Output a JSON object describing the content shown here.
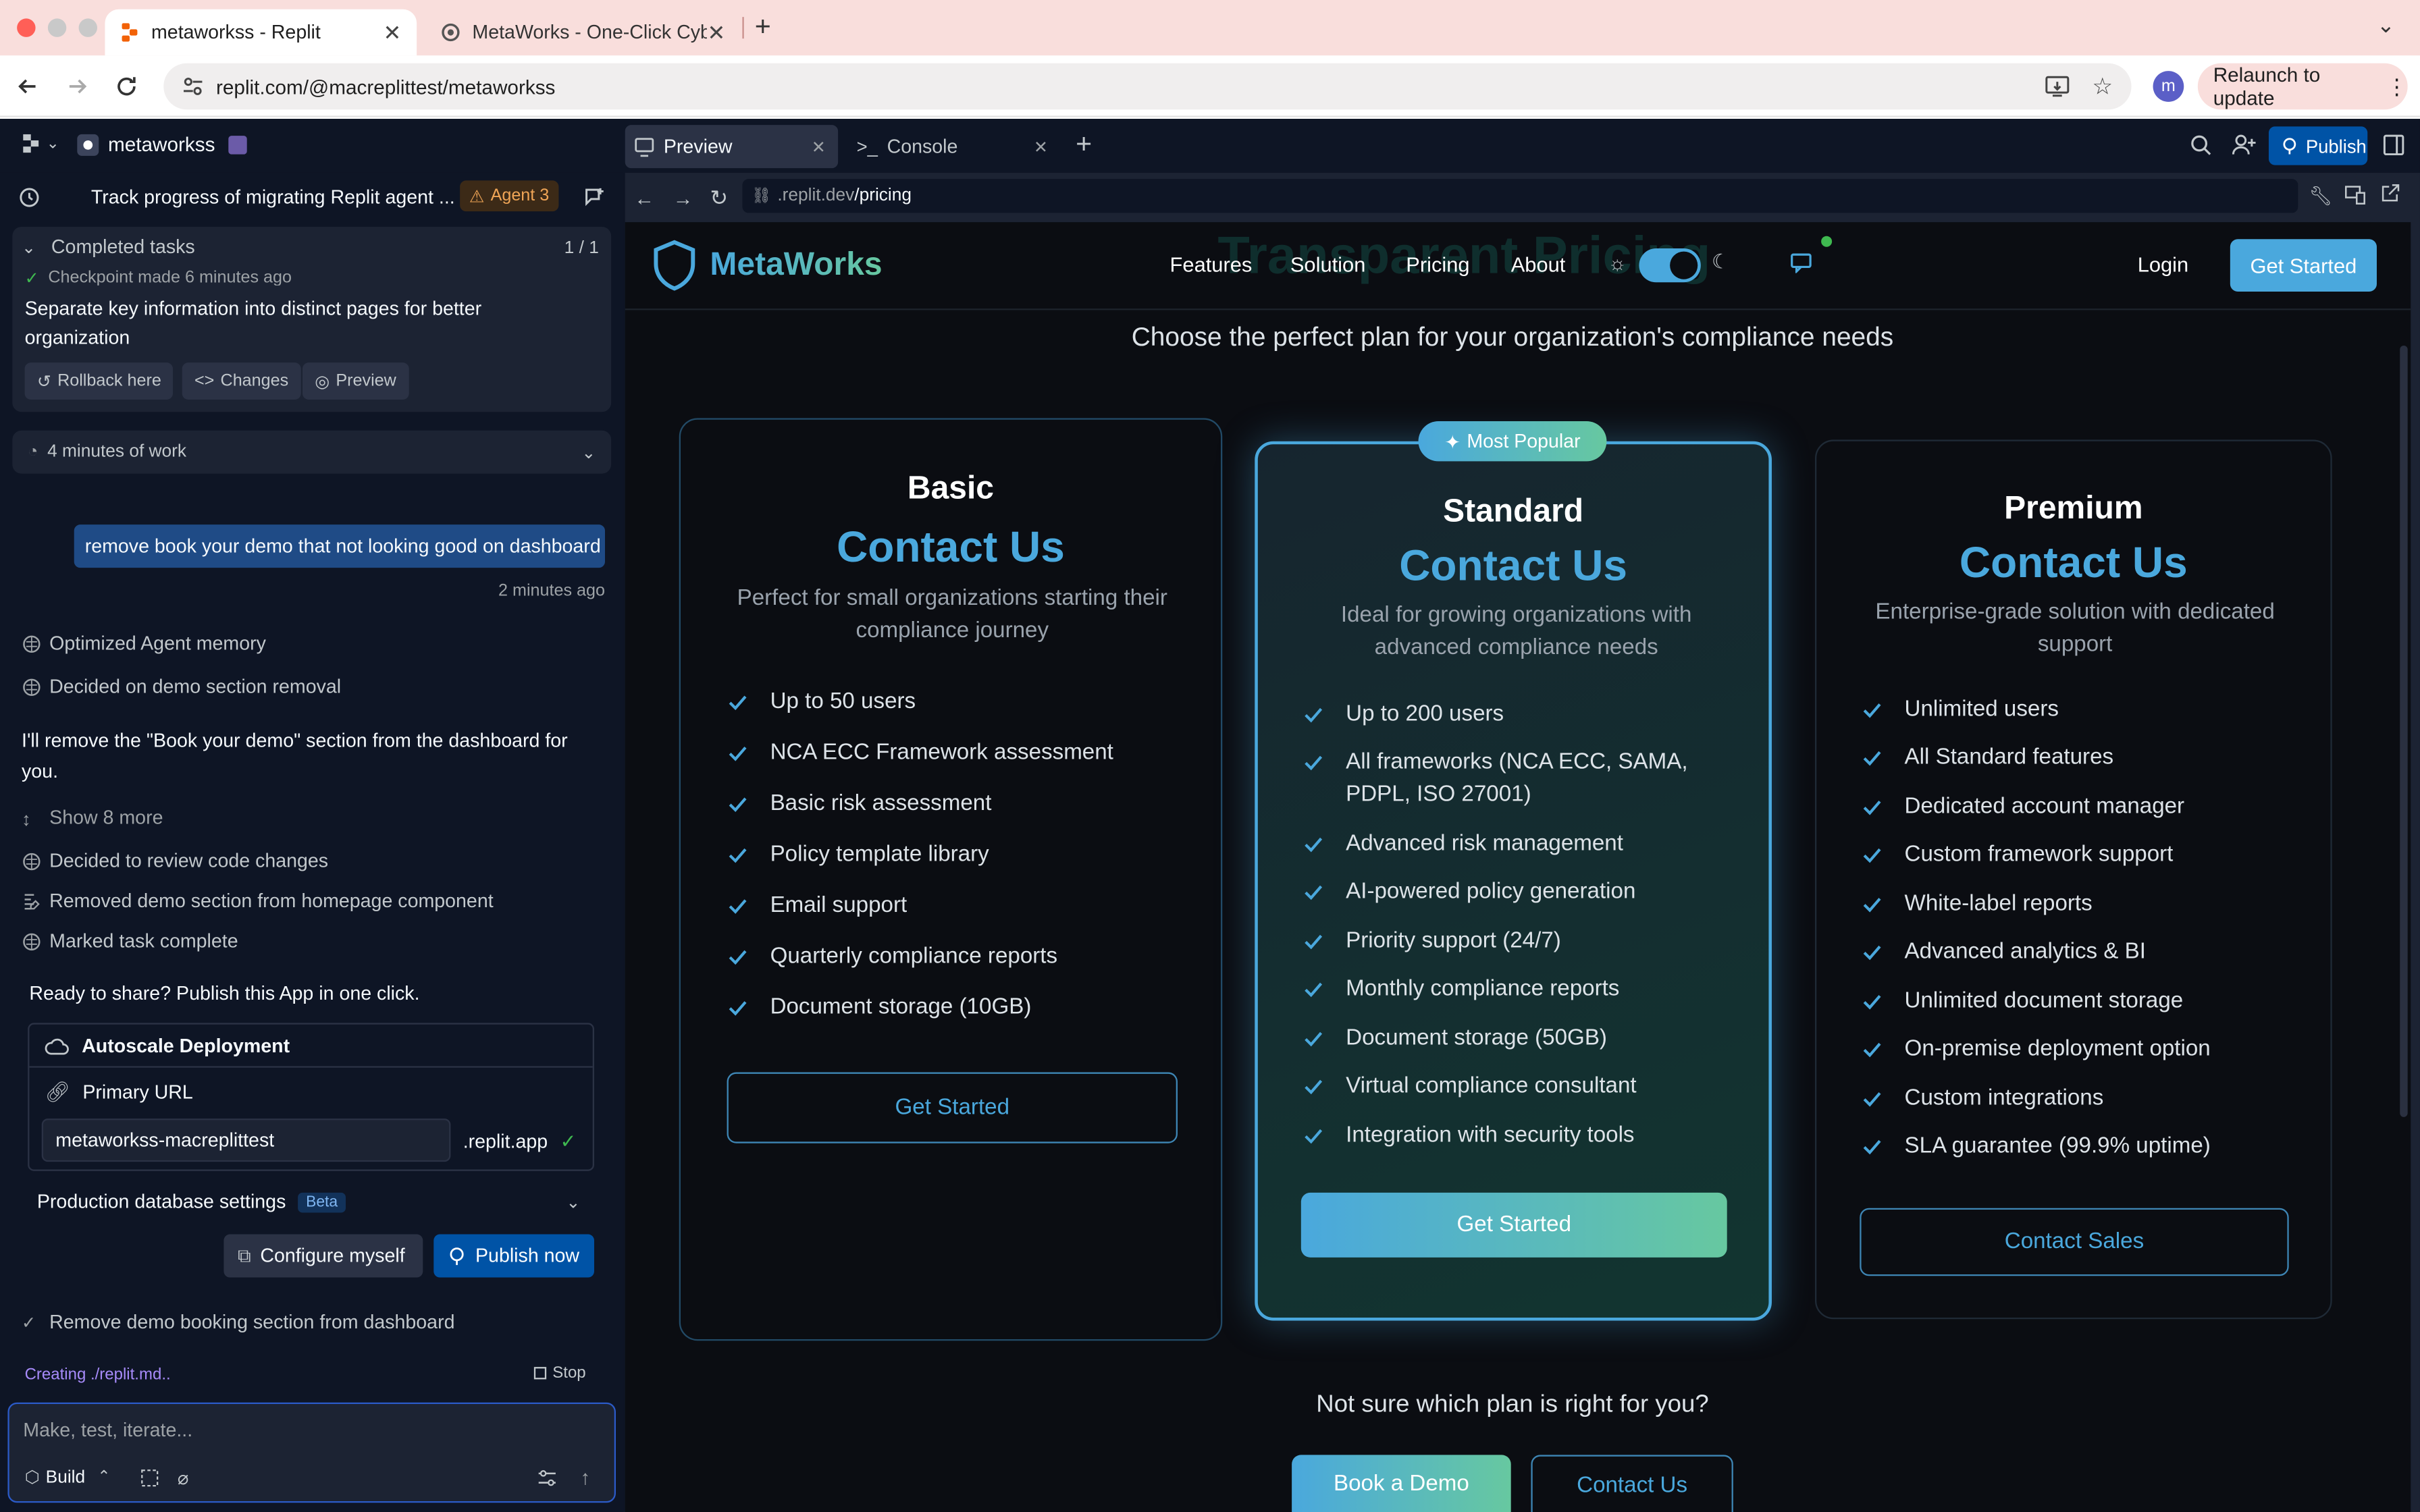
{
  "browser": {
    "tabs": [
      {
        "title": "metaworkss - Replit"
      },
      {
        "title": "MetaWorks - One-Click Cyber..."
      }
    ],
    "url": "replit.com/@macreplittest/metaworkss",
    "relaunch_label": "Relaunch to update",
    "profile_initial": "m"
  },
  "replit": {
    "repl_name": "metaworkss",
    "tabs": [
      {
        "label": "Preview"
      },
      {
        "label": "Console"
      }
    ],
    "publish_label": "Publish",
    "preview_url_prefix": ".replit.dev",
    "preview_url_path": "/pricing"
  },
  "agent": {
    "thread_title": "Track progress of migrating Replit agent ...",
    "agent_badge": "Agent 3",
    "completed_tasks_label": "Completed tasks",
    "completed_tasks_count": "1 / 1",
    "checkpoint_text": "Checkpoint made 6 minutes ago",
    "checkpoint_desc": "Separate key information into distinct pages for better organization",
    "rollback_label": "Rollback here",
    "changes_label": "Changes",
    "preview_label": "Preview",
    "work_time": "4 minutes of work",
    "user_message": "remove book your demo that not looking good on dashboard",
    "user_message_time": "2 minutes ago",
    "steps_top": [
      "Optimized Agent memory",
      "Decided on demo section removal"
    ],
    "reply_text": "I'll remove the \"Book your demo\" section from the dashboard for you.",
    "show_more": "Show 8 more",
    "steps_bottom": [
      "Decided to review code changes",
      "Removed demo section from homepage component",
      "Marked task complete"
    ],
    "publish_prompt": "Ready to share? Publish this App in one click.",
    "deployment_label": "Autoscale Deployment",
    "primary_url_label": "Primary URL",
    "url_value": "metaworkss-macreplittest",
    "url_suffix": ".replit.app",
    "db_settings_label": "Production database settings",
    "beta_badge": "Beta",
    "configure_label": "Configure myself",
    "publish_now_label": "Publish now",
    "task_done": "Remove demo booking section from dashboard",
    "status_text": "Creating ./replit.md..",
    "stop_label": "Stop",
    "input_placeholder": "Make, test, iterate...",
    "build_label": "Build"
  },
  "site": {
    "brand": "MetaWorks",
    "nav_links": [
      "Features",
      "Solution",
      "Pricing",
      "About"
    ],
    "login_label": "Login",
    "cta_label": "Get Started",
    "ghost_heading": "Transparent Pricing",
    "subtitle": "Choose the perfect plan for your organization's compliance needs",
    "plans": [
      {
        "name": "Basic",
        "price": "Contact Us",
        "description": "Perfect for small organizations starting their compliance journey",
        "features": [
          "Up to 50 users",
          "NCA ECC Framework assessment",
          "Basic risk assessment",
          "Policy template library",
          "Email support",
          "Quarterly compliance reports",
          "Document storage (10GB)"
        ],
        "button": "Get Started"
      },
      {
        "name": "Standard",
        "badge": "Most Popular",
        "price": "Contact Us",
        "description": "Ideal for growing organizations with advanced compliance needs",
        "features": [
          "Up to 200 users",
          "All frameworks (NCA ECC, SAMA, PDPL, ISO 27001)",
          "Advanced risk management",
          "AI-powered policy generation",
          "Priority support (24/7)",
          "Monthly compliance reports",
          "Document storage (50GB)",
          "Virtual compliance consultant",
          "Integration with security tools"
        ],
        "button": "Get Started"
      },
      {
        "name": "Premium",
        "price": "Contact Us",
        "description": "Enterprise-grade solution with dedicated support",
        "features": [
          "Unlimited users",
          "All Standard features",
          "Dedicated account manager",
          "Custom framework support",
          "White-label reports",
          "Advanced analytics & BI",
          "Unlimited document storage",
          "On-premise deployment option",
          "Custom integrations",
          "SLA guarantee (99.9% uptime)"
        ],
        "button": "Contact Sales"
      }
    ],
    "not_sure": "Not sure which plan is right for you?",
    "book_demo": "Book a Demo",
    "contact_us": "Contact Us"
  },
  "colors": {
    "accent": "#4aa8dd",
    "replit_bg": "#0e1525",
    "site_bg": "#0b0d12",
    "publish_blue": "#0053a6"
  }
}
